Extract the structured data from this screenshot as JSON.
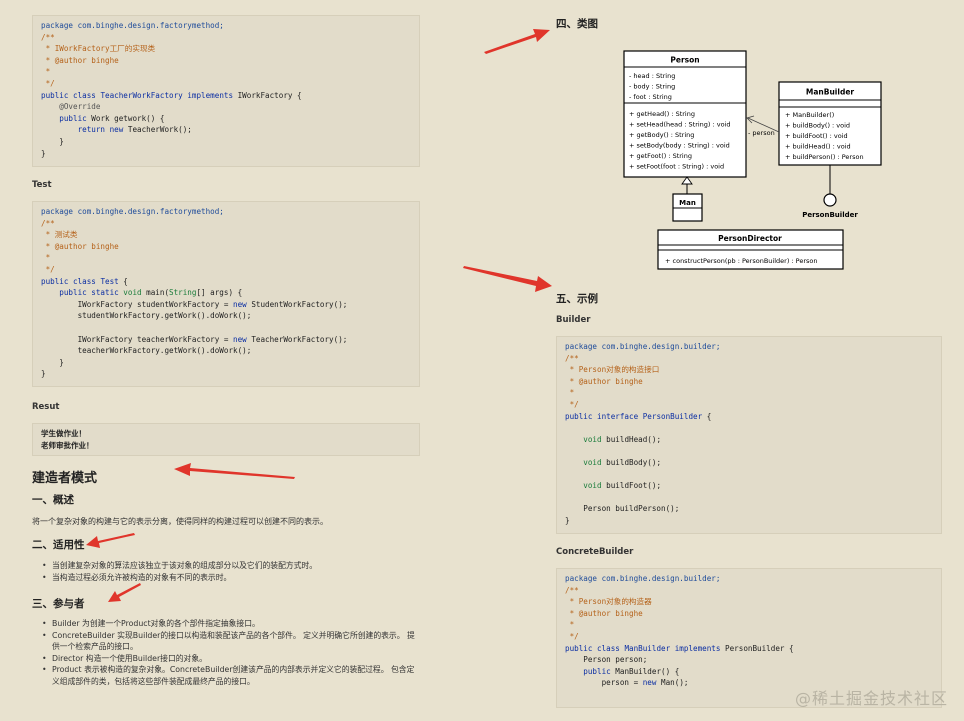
{
  "left": {
    "code1": [
      [
        [
          "pk",
          "package com.binghe.design.factorymethod;"
        ]
      ],
      [
        [
          "cm",
          "/**"
        ]
      ],
      [
        [
          "cm",
          " * IWorkFactory工厂的实现类"
        ]
      ],
      [
        [
          "cm",
          " * @author binghe"
        ]
      ],
      [
        [
          "cm",
          " *"
        ]
      ],
      [
        [
          "cm",
          " */"
        ]
      ],
      [
        [
          "kw",
          "public class "
        ],
        [
          "cl",
          "TeacherWorkFactory "
        ],
        [
          "kw",
          "implements "
        ],
        [
          "t",
          "IWorkFactory {"
        ]
      ],
      [
        [
          "an",
          "    @Override"
        ]
      ],
      [
        [
          "kw",
          "    public "
        ],
        [
          "t",
          "Work getwork() {"
        ]
      ],
      [
        [
          "kw",
          "        return new "
        ],
        [
          "t",
          "TeacherWork();"
        ]
      ],
      [
        [
          "t",
          "    }"
        ]
      ],
      [
        [
          "t",
          "}"
        ]
      ]
    ],
    "test_label": "Test",
    "code2": [
      [
        [
          "pk",
          "package com.binghe.design.factorymethod;"
        ]
      ],
      [
        [
          "cm",
          "/**"
        ]
      ],
      [
        [
          "cm",
          " * 测试类"
        ]
      ],
      [
        [
          "cm",
          " * @author binghe"
        ]
      ],
      [
        [
          "cm",
          " *"
        ]
      ],
      [
        [
          "cm",
          " */"
        ]
      ],
      [
        [
          "kw",
          "public class "
        ],
        [
          "cl",
          "Test "
        ],
        [
          "t",
          "{"
        ]
      ],
      [
        [
          "kw",
          "    public static "
        ],
        [
          "ty",
          "void "
        ],
        [
          "t",
          "main("
        ],
        [
          "ty",
          "String"
        ],
        [
          "t",
          "[] args) {"
        ]
      ],
      [
        [
          "t",
          "        IWorkFactory studentWorkFactory = "
        ],
        [
          "kw",
          "new "
        ],
        [
          "t",
          "StudentWorkFactory();"
        ]
      ],
      [
        [
          "t",
          "        studentWorkFactory.getWork().doWork();"
        ]
      ],
      [
        [
          "t",
          ""
        ]
      ],
      [
        [
          "t",
          "        IWorkFactory teacherWorkFactory = "
        ],
        [
          "kw",
          "new "
        ],
        [
          "t",
          "TeacherWorkFactory();"
        ]
      ],
      [
        [
          "t",
          "        teacherWorkFactory.getWork().doWork();"
        ]
      ],
      [
        [
          "t",
          "    }"
        ]
      ],
      [
        [
          "t",
          "}"
        ]
      ]
    ],
    "result_label": "Resut",
    "result_lines": [
      "学生做作业！",
      "老师审批作业！"
    ],
    "section_title": "建造者模式",
    "overview_title": "一、概述",
    "overview_text": "将一个复杂对象的构建与它的表示分离，使得同样的构建过程可以创建不同的表示。",
    "applicability_title": "二、适用性",
    "applicability_items": [
      "当创建复杂对象的算法应该独立于该对象的组成部分以及它们的装配方式时。",
      "当构造过程必须允许被构造的对象有不同的表示时。"
    ],
    "participants_title": "三、参与者",
    "participants_items": [
      "Builder 为创建一个Product对象的各个部件指定抽象接口。",
      "ConcreteBuilder 实现Builder的接口以构造和装配该产品的各个部件。 定义并明确它所创建的表示。 提供一个检索产品的接口。",
      "Director 构造一个使用Builder接口的对象。",
      "Product 表示被构造的复杂对象。ConcreteBuilder创建该产品的内部表示并定义它的装配过程。 包含定义组成部件的类，包括将这些部件装配成最终产品的接口。"
    ]
  },
  "right": {
    "class_diagram_title": "四、类图",
    "uml": {
      "person": {
        "name": "Person",
        "fields": [
          "- head : String",
          "- body : String",
          "- foot : String"
        ],
        "methods": [
          "+ getHead() : String",
          "+ setHead(head : String) : void",
          "+ getBody() : String",
          "+ setBody(body : String) : void",
          "+ getFoot() : String",
          "+ setFoot(foot : String) : void"
        ]
      },
      "man_builder": {
        "name": "ManBuilder",
        "methods": [
          "+ ManBuilder()",
          "+ buildBody() : void",
          "+ buildFoot() : void",
          "+ buildHead() : void",
          "+ buildPerson() : Person"
        ]
      },
      "man": {
        "name": "Man"
      },
      "person_builder": {
        "name": "PersonBuilder"
      },
      "assoc_label": "- person",
      "person_director": {
        "name": "PersonDirector",
        "methods": [
          "+ constructPerson(pb : PersonBuilder) : Person"
        ]
      }
    },
    "example_title": "五、示例",
    "builder_label": "Builder",
    "code3": [
      [
        [
          "pk",
          "package com.binghe.design.builder;"
        ]
      ],
      [
        [
          "cm",
          "/**"
        ]
      ],
      [
        [
          "cm",
          " * Person对象的构造接口"
        ]
      ],
      [
        [
          "cm",
          " * @author binghe"
        ]
      ],
      [
        [
          "cm",
          " *"
        ]
      ],
      [
        [
          "cm",
          " */"
        ]
      ],
      [
        [
          "kw",
          "public interface "
        ],
        [
          "cl",
          "PersonBuilder "
        ],
        [
          "t",
          "{"
        ]
      ],
      [
        [
          "t",
          ""
        ]
      ],
      [
        [
          "ty",
          "    void "
        ],
        [
          "t",
          "buildHead();"
        ]
      ],
      [
        [
          "t",
          ""
        ]
      ],
      [
        [
          "ty",
          "    void "
        ],
        [
          "t",
          "buildBody();"
        ]
      ],
      [
        [
          "t",
          ""
        ]
      ],
      [
        [
          "ty",
          "    void "
        ],
        [
          "t",
          "buildFoot();"
        ]
      ],
      [
        [
          "t",
          ""
        ]
      ],
      [
        [
          "t",
          "    Person buildPerson();"
        ]
      ],
      [
        [
          "t",
          "}"
        ]
      ]
    ],
    "concrete_label": "ConcreteBuilder",
    "code4": [
      [
        [
          "pk",
          "package com.binghe.design.builder;"
        ]
      ],
      [
        [
          "cm",
          "/**"
        ]
      ],
      [
        [
          "cm",
          " * Person对象的构造器"
        ]
      ],
      [
        [
          "cm",
          " * @author binghe"
        ]
      ],
      [
        [
          "cm",
          " *"
        ]
      ],
      [
        [
          "cm",
          " */"
        ]
      ],
      [
        [
          "kw",
          "public class "
        ],
        [
          "cl",
          "ManBuilder "
        ],
        [
          "kw",
          "implements "
        ],
        [
          "t",
          "PersonBuilder {"
        ]
      ],
      [
        [
          "t",
          "    Person person;"
        ]
      ],
      [
        [
          "kw",
          "    public "
        ],
        [
          "t",
          "ManBuilder() {"
        ]
      ],
      [
        [
          "t",
          "        person = "
        ],
        [
          "kw",
          "new "
        ],
        [
          "t",
          "Man();"
        ]
      ]
    ]
  },
  "watermark": "@稀土掘金技术社区",
  "colors": {
    "arrow": "#e0352b",
    "background": "#e8e2cf",
    "code_bg": "#e2dcca"
  }
}
